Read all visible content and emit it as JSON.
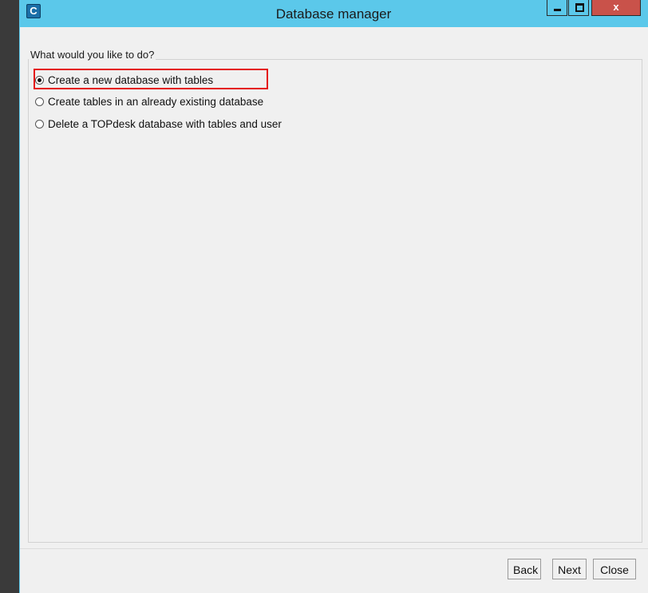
{
  "window": {
    "title": "Database manager",
    "app_icon_glyph": "C",
    "controls": {
      "minimize": "minimize-icon",
      "maximize": "maximize-icon",
      "close_label": "x"
    }
  },
  "group": {
    "legend": "What would you like to do?",
    "options": [
      {
        "label": "Create a new database with tables",
        "selected": true
      },
      {
        "label": "Create tables in an already existing database",
        "selected": false
      },
      {
        "label": "Delete a TOPdesk database with tables and user",
        "selected": false
      }
    ]
  },
  "buttons": {
    "back": "Back",
    "next": "Next",
    "close": "Close"
  },
  "colors": {
    "titlebar": "#5bc8ea",
    "highlight": "#e41414",
    "close_button": "#c9524a"
  }
}
